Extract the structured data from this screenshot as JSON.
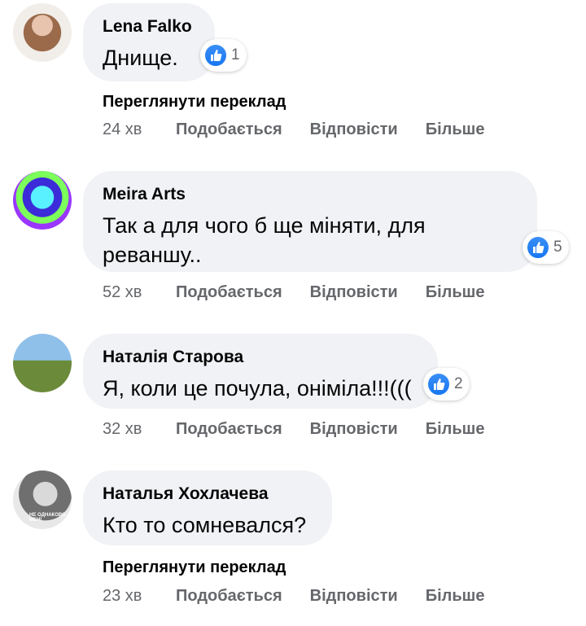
{
  "comments": [
    {
      "author": "Lena Falko",
      "text": "Днище.",
      "reactions": "1",
      "translate": "Переглянути переклад",
      "time": "24 хв",
      "like": "Подобається",
      "reply": "Відповісти",
      "more": "Більше"
    },
    {
      "author": "Meira Arts",
      "text_line1": "Так а для чого б ще міняти, для",
      "text_line2": "реваншу..",
      "reactions": "5",
      "time": "52 хв",
      "like": "Подобається",
      "reply": "Відповісти",
      "more": "Більше"
    },
    {
      "author": "Наталія Старова",
      "text": "Я, коли це почула, оніміла!!!(((",
      "reactions": "2",
      "time": "32 хв",
      "like": "Подобається",
      "reply": "Відповісти",
      "more": "Більше"
    },
    {
      "author": "Наталья Хохлачева",
      "text": "Кто то сомневался?",
      "avatar_caption": "НЕ ОДНАКОВО МЕНІ",
      "translate": "Переглянути переклад",
      "time": "23 хв",
      "like": "Подобається",
      "reply": "Відповісти",
      "more": "Більше"
    }
  ],
  "icons": {
    "reaction": "like-thumb-icon"
  },
  "colors": {
    "like_blue": "#1877f2",
    "bubble_bg": "#f0f2f5",
    "meta_gray": "#65676b"
  }
}
